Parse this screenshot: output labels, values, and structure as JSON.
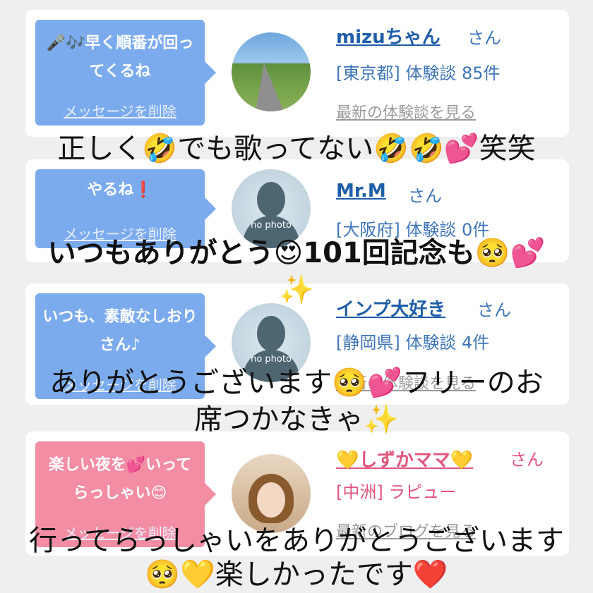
{
  "cards": [
    {
      "message": "🎤🎶早く順番が回ってくるね",
      "delete_label": "メッセージを削除",
      "name": "mizuちゃん",
      "honorific": "さん",
      "info": "[東京都] 体験談 85件",
      "link": "最新の体験談を見る"
    },
    {
      "message": "やるね❗",
      "delete_label": "メッセージを削除",
      "avatar_text": "no photo",
      "name": "Mr.M",
      "honorific": "さん",
      "info": "[大阪府] 体験談 0件",
      "link": "最新の体験談を見る"
    },
    {
      "message": "いつも、素敵なしおりさん♪",
      "delete_label": "メッセージを削除",
      "avatar_text": "no photo",
      "name": "インプ大好き",
      "honorific": "さん",
      "info": "[静岡県] 体験談 4件",
      "link": "最新の体験談を見る"
    },
    {
      "message": "楽しい夜を💕いってらっしゃい😊",
      "delete_label": "メッセージを削除",
      "name": "💛しずかママ💛",
      "honorific": "さん",
      "info": "[中洲] ラピュー",
      "link": "最新のブログを見る"
    }
  ],
  "captions": [
    "正しく🤣でも歌ってない🤣🤣💕笑笑",
    "いつもありがとう😍101回記念も🥺💕",
    "✨",
    "ありがとうございます🥺💕フリーのお",
    "席つかなきゃ✨",
    "行ってらっしゃいをありがとうございます",
    "🥺💛楽しかったです❤️"
  ],
  "colors": {
    "bubble_blue": "#7cabed",
    "bubble_pink": "#f28da4",
    "name_blue": "#1f5ea8",
    "name_pink": "#e2557d"
  }
}
